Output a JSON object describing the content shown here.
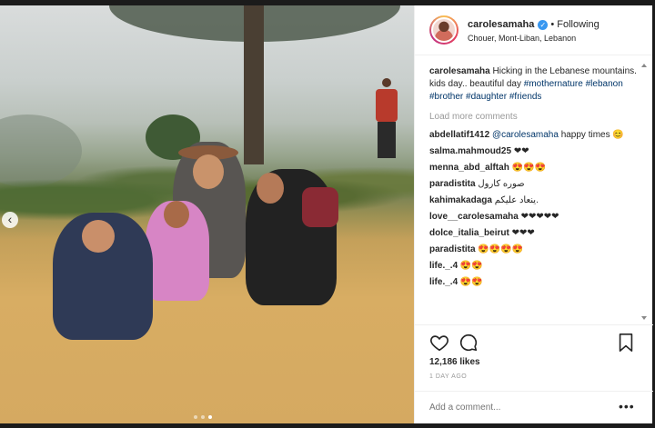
{
  "post": {
    "username": "carolesamaha",
    "verified_icon": "verified-check-icon",
    "separator": "•",
    "follow_state": "Following",
    "location": "Chouer, Mont-Liban, Lebanon"
  },
  "caption": {
    "username": "carolesamaha",
    "text": "Hicking in the Lebanese mountains. kids day.. beautiful day",
    "hashtags": [
      "#mothernature",
      "#lebanon",
      "#brother",
      "#daughter",
      "#friends"
    ]
  },
  "load_more_label": "Load more comments",
  "comments": [
    {
      "user": "abdellatif1412",
      "mention": "@carolesamaha",
      "text": "happy times 😊"
    },
    {
      "user": "salma.mahmoud25",
      "text": "❤❤"
    },
    {
      "user": "menna_abd_alftah",
      "text": "😍😍😍"
    },
    {
      "user": "paradistita",
      "text": "صوره كارول"
    },
    {
      "user": "kahimakadaga",
      "text": "ينعاد عليكم."
    },
    {
      "user": "love__carolesamaha",
      "text": "❤❤❤❤❤"
    },
    {
      "user": "dolce_italia_beirut",
      "text": "❤❤❤"
    },
    {
      "user": "paradistita",
      "text": "😍😍😍😍"
    },
    {
      "user": "life._.4",
      "text": "😍😍"
    },
    {
      "user": "life._.4",
      "text": "😍😍"
    }
  ],
  "likes": "12,186 likes",
  "time": "1 DAY AGO",
  "add_comment_placeholder": "Add a comment...",
  "more_label": "•••",
  "carousel": {
    "prev_label": "‹",
    "total": 3,
    "active": 2
  }
}
